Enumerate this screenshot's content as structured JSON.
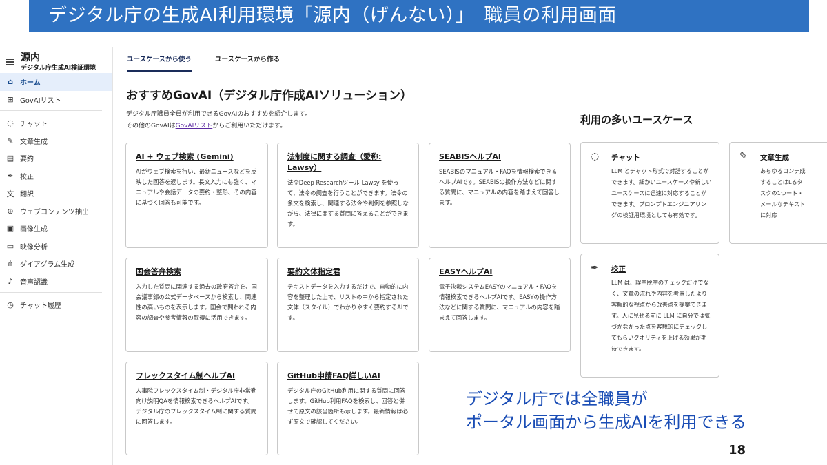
{
  "banner": {
    "title": "デジタル庁の生成AI利用環境「源内（げんない）」　職員の利用画面"
  },
  "sidebar": {
    "brand_name": "源内",
    "brand_sub": "デジタル庁生成AI検証環境",
    "items": [
      {
        "label": "ホーム",
        "icon": "home-icon",
        "glyph": "⌂"
      },
      {
        "label": "GovAIリスト",
        "icon": "grid-icon",
        "glyph": "⊞"
      },
      {
        "label": "チャット",
        "icon": "chat-icon",
        "glyph": "◌"
      },
      {
        "label": "文章生成",
        "icon": "pencil-icon",
        "glyph": "✎"
      },
      {
        "label": "要約",
        "icon": "document-icon",
        "glyph": "▤"
      },
      {
        "label": "校正",
        "icon": "pen-nib-icon",
        "glyph": "✒"
      },
      {
        "label": "翻訳",
        "icon": "translate-icon",
        "glyph": "文"
      },
      {
        "label": "ウェブコンテンツ抽出",
        "icon": "globe-icon",
        "glyph": "⊕"
      },
      {
        "label": "画像生成",
        "icon": "image-icon",
        "glyph": "▣"
      },
      {
        "label": "映像分析",
        "icon": "video-icon",
        "glyph": "▭"
      },
      {
        "label": "ダイアグラム生成",
        "icon": "diagram-icon",
        "glyph": "⋔"
      },
      {
        "label": "音声認識",
        "icon": "speaker-icon",
        "glyph": "♪"
      },
      {
        "label": "チャット履歴",
        "icon": "history-icon",
        "glyph": "◷"
      }
    ]
  },
  "tabs": [
    {
      "label": "ユースケースから使う"
    },
    {
      "label": "ユースケースから作る"
    }
  ],
  "main": {
    "title": "おすすめGovAI（デジタル庁作成AIソリューション）",
    "intro_line1": "デジタル庁職員全員が利用できるGovAIのおすすめを紹介します。",
    "intro_line2_pre": "その他のGovAIは",
    "intro_link": "GovAIリスト",
    "intro_line2_post": "からご利用いただけます。",
    "cards": [
      {
        "title": "AI + ウェブ検索 (Gemini)",
        "desc": "AIがウェブ検索を行い、最新ニュースなどを反映した回答を返します。長文入力にも強く、マニュアルや会話データの要約・整形、その内容に基づく回答も可能です。"
      },
      {
        "title": "法制度に関する調査（愛称: Lawsy）",
        "desc": "法令Deep Researchツール Lawsy を使って、法令の調査を行うことができます。法令の条文を検索し、関連する法令や判例を参照しながら、法律に関する質問に答えることができます。"
      },
      {
        "title": "SEABISヘルプAI",
        "desc": "SEABISのマニュアル・FAQを情報検索できるヘルプAIです。SEABISの操作方法などに関する質問に、マニュアルの内容を踏まえて回答します。"
      },
      {
        "title": "国会答弁検索",
        "desc": "入力した質問に関連する過去の政府答弁を、国会議事録の公式データベースから検索し、関連性の高いものを表示します。国会で問われる内容の調査や参考情報の取得に活用できます。"
      },
      {
        "title": "要約文体指定君",
        "desc": "テキストデータを入力するだけで、自動的に内容を整理した上で、リストの中から指定された文体（スタイル）でわかりやすく要約するAIです。"
      },
      {
        "title": "EASYヘルプAI",
        "desc": "電子決裁システムEASYのマニュアル・FAQを情報検索できるヘルプAIです。EASYの操作方法などに関する質問に、マニュアルの内容を踏まえて回答します。"
      },
      {
        "title": "フレックスタイム制ヘルプAI",
        "desc": "人事院フレックスタイム制・デジタル庁非常勤向け説明QAを情報検索できるヘルプAIです。デジタル庁のフレックスタイム制に関する質問に回答します。"
      },
      {
        "title": "GitHub申請FAQ詳しいAI",
        "desc": "デジタル庁のGitHub利用に関する質問に回答します。GitHub利用FAQを検索し、回答と併せて原文の該当箇所も示します。最新情報は必ず原文で確認してください。"
      }
    ]
  },
  "usecases": {
    "heading": "利用の多いユースケース",
    "items": [
      {
        "title": "チャット",
        "icon": "chat-icon",
        "glyph": "◌",
        "desc": "LLM とチャット形式で対話することができます。細かいユースケースや新しいユースケースに迅速に対応することができます。プロンプトエンジニアリングの検証用環境としても有効です。"
      },
      {
        "title": "文章生成",
        "icon": "pencil-icon",
        "glyph": "✎",
        "desc": "あらゆるコンテ成することはLるタスクの1つート・メールなテキストに対応"
      },
      {
        "title": "校正",
        "icon": "pen-nib-icon",
        "glyph": "✒",
        "desc": "LLM は、誤字脱字のチェックだけでなく、文章の流れや内容を考慮したより客観的な視点から改善点を提案できます。人に見せる前に LLM に自分では気づかなかった点を客観的にチェックしてもらいクオリティを上げる効果が期待できます。"
      }
    ]
  },
  "callout": {
    "line1": "デジタル庁では全職員が",
    "line2": "ポータル画面から生成AIを利用できる"
  },
  "page_number": "18"
}
